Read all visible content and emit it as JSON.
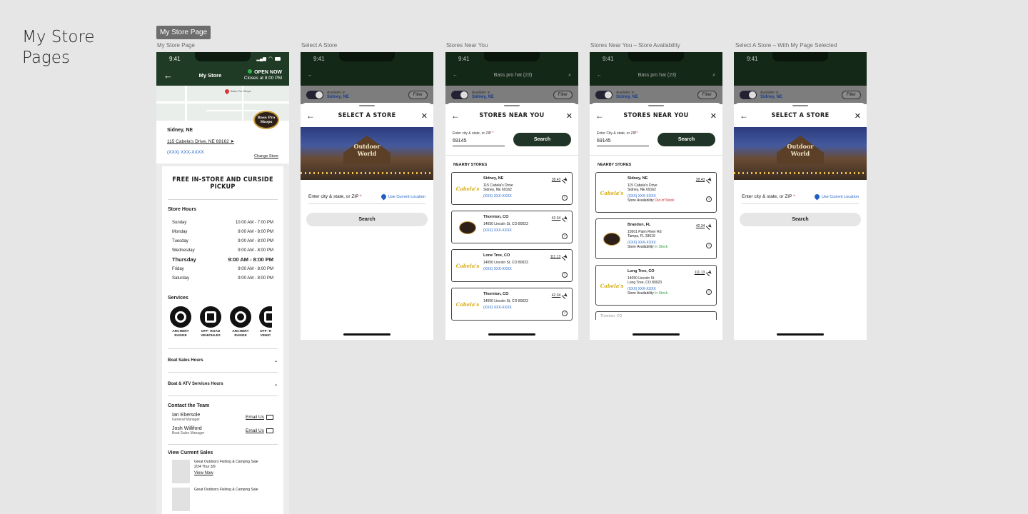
{
  "canvas": {
    "title_line1": "My Store",
    "title_line2": "Pages",
    "selected_tag": "My Store Page"
  },
  "frames": {
    "f1_label": "My Store Page",
    "f2_label": "Select A Store",
    "f3_label": "Stores Near You",
    "f4_label": "Stores Near You – Store Availability",
    "f5_label": "Select A Store – With My Page Selected"
  },
  "status": {
    "time": "9:41"
  },
  "my_store": {
    "nav_title": "My Store",
    "open_now": "OPEN NOW",
    "closes_at": "Closes at 8:00 PM",
    "map_label": "Bass Pro Shops",
    "logo_text": "Bass Pro Shops",
    "city": "Sidney, NE",
    "address": "115 Cabela's Drive, NE 69162",
    "phone": "(XXX) XXX-XXXX",
    "change_store": "Change Store",
    "pickup_banner": "FREE IN-STORE AND CURSIDE PICKUP",
    "store_hours_title": "Store Hours",
    "hours": [
      {
        "day": "Sunday",
        "time": "10:00 AM - 7:00 PM"
      },
      {
        "day": "Monday",
        "time": "9:00 AM - 8:00 PM"
      },
      {
        "day": "Tuesday",
        "time": "9:00 AM - 8:00 PM"
      },
      {
        "day": "Wednesday",
        "time": "9:00 AM - 8:00 PM"
      },
      {
        "day": "Thursday",
        "time": "9:00 AM - 8:00 PM"
      },
      {
        "day": "Friday",
        "time": "9:00 AM - 8:00 PM"
      },
      {
        "day": "Saturday",
        "time": "9:00 AM - 8:00 PM"
      }
    ],
    "services_title": "Services",
    "services": [
      {
        "line1": "ARCHERY",
        "line2": "RANGE"
      },
      {
        "line1": "OFF- ROAD",
        "line2": "VEHICHLES"
      },
      {
        "line1": "ARCHERY",
        "line2": "RANGE"
      },
      {
        "line1": "OFF- R",
        "line2": "VEHIC"
      }
    ],
    "boat_sales_hours": "Boat Sales Hours",
    "boat_atv_hours": "Boat & ATV Services Hours",
    "contact_title": "Contact the Team",
    "team": [
      {
        "name": "Ian Ebersole",
        "role": "General Manager",
        "email": "Email Us"
      },
      {
        "name": "Josh Williford",
        "role": "Boat Sales Manager",
        "email": "Email Us"
      }
    ],
    "sales_title": "View Current Sales",
    "sales": [
      {
        "title": "Great Outdoors Fishing & Camping Sale",
        "dates": "2/24 Thur 3/9",
        "link": "View Now"
      },
      {
        "title": "Great Outdoors Fishing & Camping Sale"
      }
    ]
  },
  "background_screen": {
    "search_title": "Bass pro hat (23)",
    "available_in": "Available in",
    "available_city": "Sidney, NE",
    "filter": "Filter"
  },
  "select_store": {
    "title": "SELECT A STORE",
    "hero_sign": "Outdoor World",
    "zip_placeholder": "Enter city & state, or ZIP",
    "required_mark": "*",
    "use_current_location": "Use Current Location",
    "search": "Search"
  },
  "stores_near": {
    "title": "STORES NEAR YOU",
    "field_label_a": "Enter city & state, or ZIP",
    "field_label_b": "Enter City & state, or ZIP",
    "field_value": "69145",
    "search": "Search",
    "nearby_label": "NEARBY STORES",
    "logo_text": "Cabela's",
    "stores": [
      {
        "name": "Sidney, NE",
        "line1": "115 Cabela's Drive",
        "line2": "Sidney, NE 69162",
        "phone": "(XXX) XXX-XXXX",
        "distance": "38.43"
      },
      {
        "name": "Thornton, CO",
        "line1": "14050 Lincoln St, CO 80023",
        "line2": "",
        "phone": "(XXX) XXX-XXXX",
        "distance": "42.34"
      },
      {
        "name": "Lone Tree, CO",
        "line1": "14050 Lincoln St, CO 80023",
        "line2": "",
        "phone": "(XXX) XXX-XXXX",
        "distance": "111.13"
      },
      {
        "name": "Thornton, CO",
        "line1": "14050 Lincoln St, CO 80023",
        "line2": "",
        "phone": "(XXX) XXX-XXXX",
        "distance": "42.34"
      }
    ],
    "avail_label": "Store Availability",
    "out_of_stock": "Out of Stock",
    "in_stock": "In Stock",
    "stores_avail": [
      {
        "name": "Sidney, NE",
        "line1": "115 Cabela's Drive",
        "line2": "Sidney, NE 69162",
        "phone": "(XXX) XXX-XXXX",
        "distance": "38.43"
      },
      {
        "name": "Brandon, FL",
        "line1": "10501 Palm River Rd",
        "line2": "Tampa, FL 33619",
        "phone": "(XXX) XXX-XXXX",
        "distance": "42.34"
      },
      {
        "name": "Long Tree, CO",
        "line1": "14050 Lincoln St",
        "line2": "Long Tree, CO 80023",
        "phone": "(XXX) XXX-XXXX",
        "distance": "111.13"
      }
    ],
    "cut_off": "Thornton, CO"
  }
}
